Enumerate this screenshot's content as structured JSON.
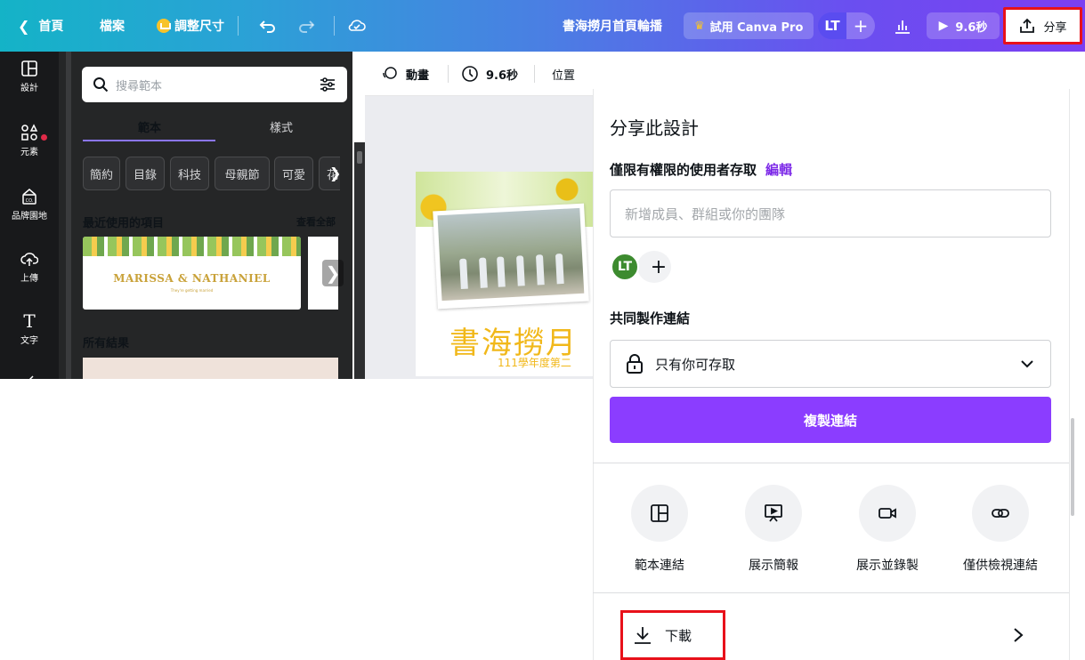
{
  "topbar": {
    "back_label": "首頁",
    "file_label": "檔案",
    "resize_label": "調整尺寸",
    "design_title": "書海撈月首頁輪播",
    "pro_label": "試用 Canva Pro",
    "avatar_initials": "LT",
    "add_label": "+",
    "present_label": "9.6秒",
    "share_label": "分享"
  },
  "rail": {
    "items": [
      {
        "label": "設計"
      },
      {
        "label": "元素"
      },
      {
        "label": "品牌園地"
      },
      {
        "label": "上傳"
      },
      {
        "label": "文字"
      }
    ]
  },
  "panel": {
    "search_placeholder": "搜尋範本",
    "tabs": [
      "範本",
      "樣式"
    ],
    "chips": [
      "簡約",
      "目錄",
      "科技",
      "母親節",
      "可愛",
      "花"
    ],
    "recent_title": "最近使用的項目",
    "see_all": "查看全部",
    "thumb_names": "MARISSA & NATHANIEL",
    "thumb_sub": "They're getting married",
    "results_title": "所有結果"
  },
  "editor": {
    "animate_label": "動畫",
    "duration_label": "9.6秒",
    "position_label": "位置",
    "design_title_text": "書海撈月",
    "design_subtitle_text": "111學年度第二"
  },
  "share": {
    "title": "分享此設計",
    "access_text": "僅限有權限的使用者存取",
    "access_edit": "編輯",
    "invite_placeholder": "新增成員、群組或你的團隊",
    "member_initials": "LT",
    "collab_label": "共同製作連結",
    "link_access": "只有你可存取",
    "copy_link": "複製連結",
    "options": [
      {
        "label": "範本連結",
        "icon": "template-icon"
      },
      {
        "label": "展示簡報",
        "icon": "present-icon"
      },
      {
        "label": "展示並錄製",
        "icon": "record-icon"
      },
      {
        "label": "僅供檢視連結",
        "icon": "link-icon"
      }
    ],
    "download_label": "下載"
  },
  "colors": {
    "accent": "#8b3dff",
    "highlight": "#e8111a",
    "edit_link": "#7d2ae8"
  }
}
